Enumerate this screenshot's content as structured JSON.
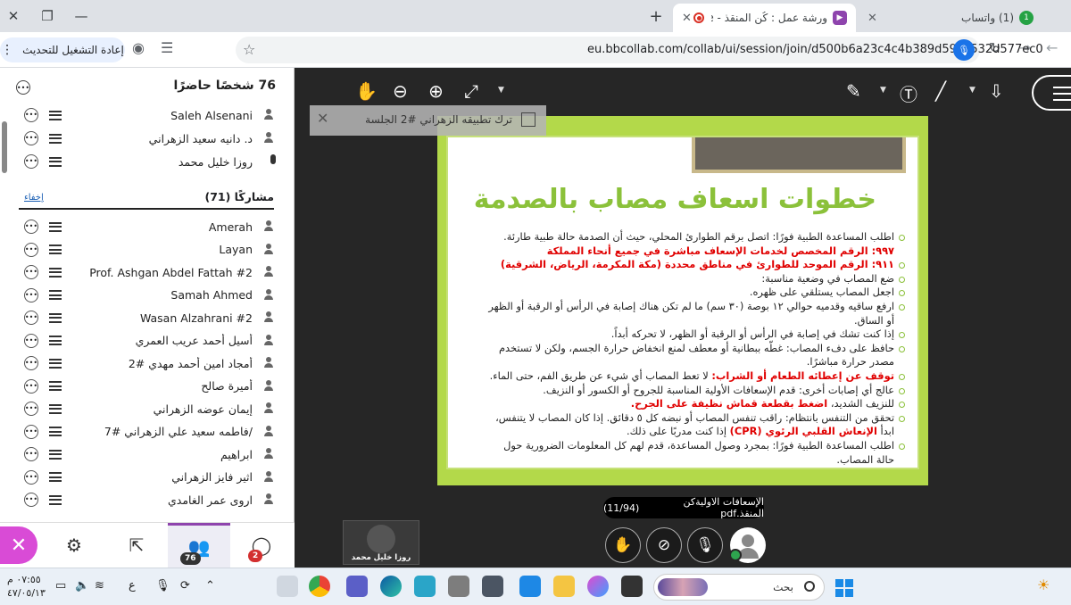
{
  "browser": {
    "tabs": [
      {
        "title": "(1) واتساب",
        "badge": "1"
      },
      {
        "title": "ورشة عمل : كُن المنقذ - orate"
      }
    ],
    "new_tab": "+",
    "window_controls": {
      "min": "—",
      "max": "❐",
      "close": "✕"
    }
  },
  "toolbar": {
    "url": "eu.bbcollab.com/collab/ui/session/join/d500b6a23c4c4b389d59c3532d577ec0",
    "update_button": "إعادة التشغيل للتحديث"
  },
  "panel": {
    "attendees_title": "76 شخصًا حاضرًا",
    "moderators": [
      {
        "name": "Saleh Alsenani"
      },
      {
        "name": "د. دانيه سعيد الزهراني"
      },
      {
        "name": "روزا خليل محمد"
      }
    ],
    "participants_header": "مشاركًا (71)",
    "hide_link": "إخفاء",
    "participants": [
      {
        "name": "Amerah"
      },
      {
        "name": "Layan"
      },
      {
        "name": "Prof. Ashgan Abdel Fattah #2"
      },
      {
        "name": "Samah Ahmed"
      },
      {
        "name": "Wasan Alzahrani #2"
      },
      {
        "name": "أسيل أحمد عريب العمري"
      },
      {
        "name": "أمجاد امين أحمد مهدي #2"
      },
      {
        "name": "أميرة صالح"
      },
      {
        "name": "إيمان عوضه الزهراني"
      },
      {
        "name": "/فاطمه سعيد علي الزهراني #7"
      },
      {
        "name": "ابراهيم"
      },
      {
        "name": "اثير فايز الزهراني"
      },
      {
        "name": "اروى عمر الغامدي"
      }
    ]
  },
  "nav": {
    "attendees_badge": "76",
    "chat_badge": "2"
  },
  "banner": {
    "text": "ترك تطبيقه الزهراني #2 الجلسة"
  },
  "slide": {
    "title": "خطوات اسعاف مصاب بالصدمة",
    "bullets": [
      {
        "text": "اطلب المساعدة الطبية فورًا: اتصل برقم الطوارئ المحلي، حيث أن الصدمة حالة طبية طارئة. ",
        "red": "٩٩٧: الرقم المخصص لخدمات الإسعاف مباشرة في جميع أنحاء المملكة"
      },
      {
        "text": "",
        "red": "٩١١: الرقم الموحد للطوارئ في مناطق محددة (مكة المكرمة، الرياض، الشرقية)"
      },
      {
        "text": "ضع المصاب في وضعية مناسبة:"
      },
      {
        "text": "اجعل المصاب يستلقي على ظهره."
      },
      {
        "text": "ارفع ساقيه وقدميه حوالي ١٢ بوصة (٣٠ سم) ما لم تكن هناك إصابة في الرأس أو الرقبة أو الظهر أو الساق."
      },
      {
        "text": "إذا كنت تشك في إصابة في الرأس أو الرقبة أو الظهر، لا تحركه أبداً."
      },
      {
        "text": "حافظ على دفء المصاب: غطّه ببطانية أو معطف لمنع انخفاض حرارة الجسم، ولكن لا تستخدم مصدر حرارة مباشرًا."
      },
      {
        "lead": "توقف عن إعطائه الطعام أو الشراب:",
        "text": " لا تعط المصاب أي شيء عن طريق الفم، حتى الماء."
      },
      {
        "text": "عالج أي إصابات أخرى: قدم الإسعافات الأولية المناسبة للجروح أو الكسور أو النزيف."
      },
      {
        "text": "للنزيف الشديد، ",
        "red": "اضغط بقطعة قماش نظيفة على الجرح."
      },
      {
        "text": "تحقق من التنفس بانتظام: راقب تنفس المصاب أو نبضه كل ٥ دقائق. إذا كان المصاب لا يتنفس، ابدأ ",
        "red": "الإنعاش القلبي الرئوي (CPR)",
        "tail": " إذا كنت مدربًا على ذلك."
      },
      {
        "text": "اطلب المساعدة الطبية فورًا: بمجرد وصول المساعدة، قدم لهم كل المعلومات الضرورية حول حالة المصاب."
      }
    ]
  },
  "file_chip": {
    "name": "الإسعافات الاوليةكن المنقذ.pdf",
    "page": "(11/94)"
  },
  "video_tile": {
    "name": "روزا خليل محمد"
  },
  "taskbar": {
    "search_label": "بحث",
    "time": "٠٧:٥٥ م",
    "date": "٤٧/٠٥/١٣",
    "lang": "ع"
  }
}
